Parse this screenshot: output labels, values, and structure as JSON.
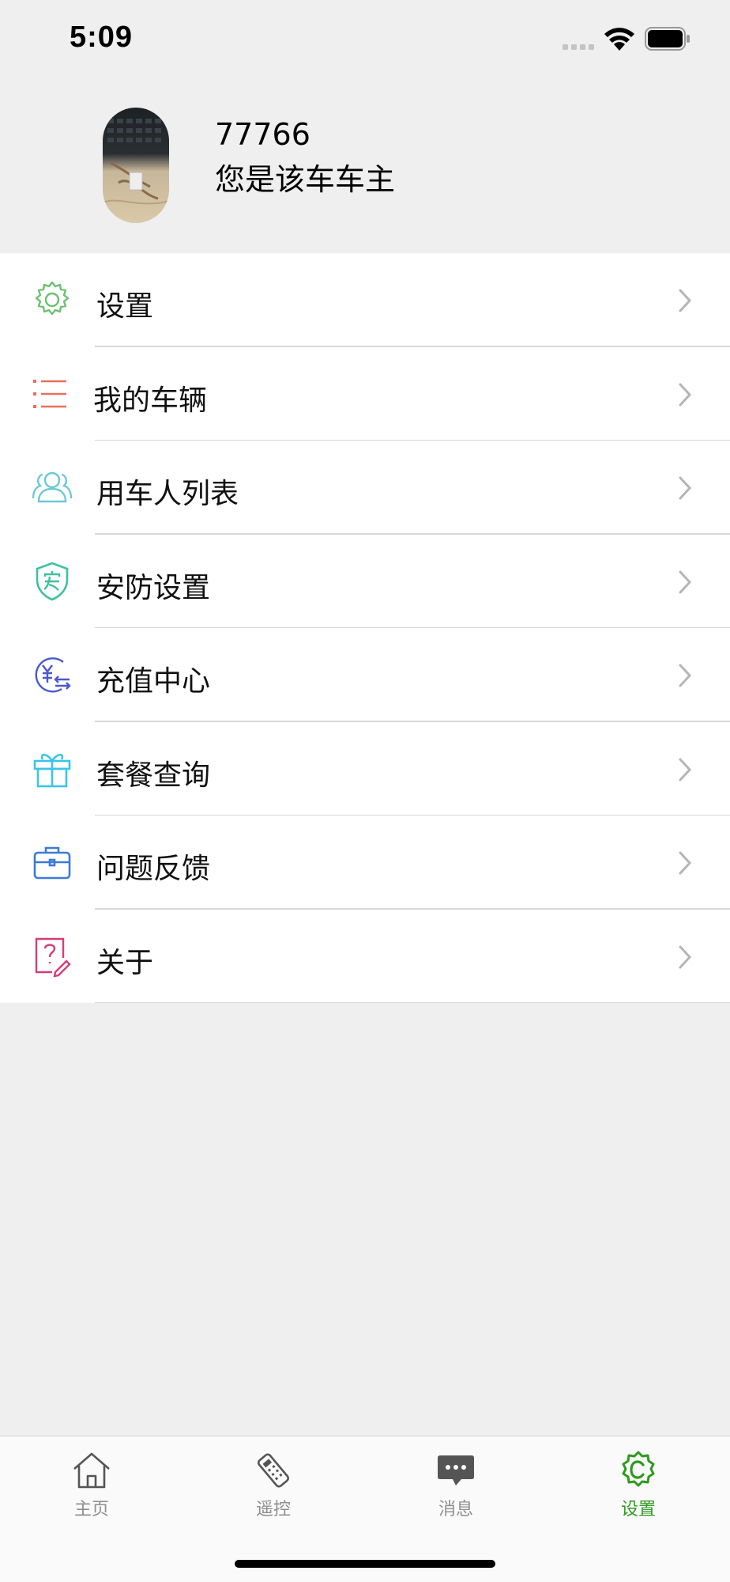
{
  "status_bar": {
    "time": "5:09"
  },
  "profile": {
    "name": "77766",
    "role": "您是该车车主"
  },
  "menu": {
    "items": [
      {
        "label": "设置",
        "icon": "gear-icon"
      },
      {
        "label": "我的车辆",
        "icon": "list-icon"
      },
      {
        "label": "用车人列表",
        "icon": "users-icon"
      },
      {
        "label": "安防设置",
        "icon": "shield-icon"
      },
      {
        "label": "充值中心",
        "icon": "yuan-exchange-icon"
      },
      {
        "label": "套餐查询",
        "icon": "gift-icon"
      },
      {
        "label": "问题反馈",
        "icon": "briefcase-icon"
      },
      {
        "label": "关于",
        "icon": "question-doc-icon"
      }
    ]
  },
  "tab_bar": {
    "tabs": [
      {
        "label": "主页",
        "icon": "home-icon"
      },
      {
        "label": "遥控",
        "icon": "remote-icon"
      },
      {
        "label": "消息",
        "icon": "message-icon"
      },
      {
        "label": "设置",
        "icon": "settings-badge-icon",
        "active": true
      }
    ],
    "active_color": "#2e9a1f"
  }
}
